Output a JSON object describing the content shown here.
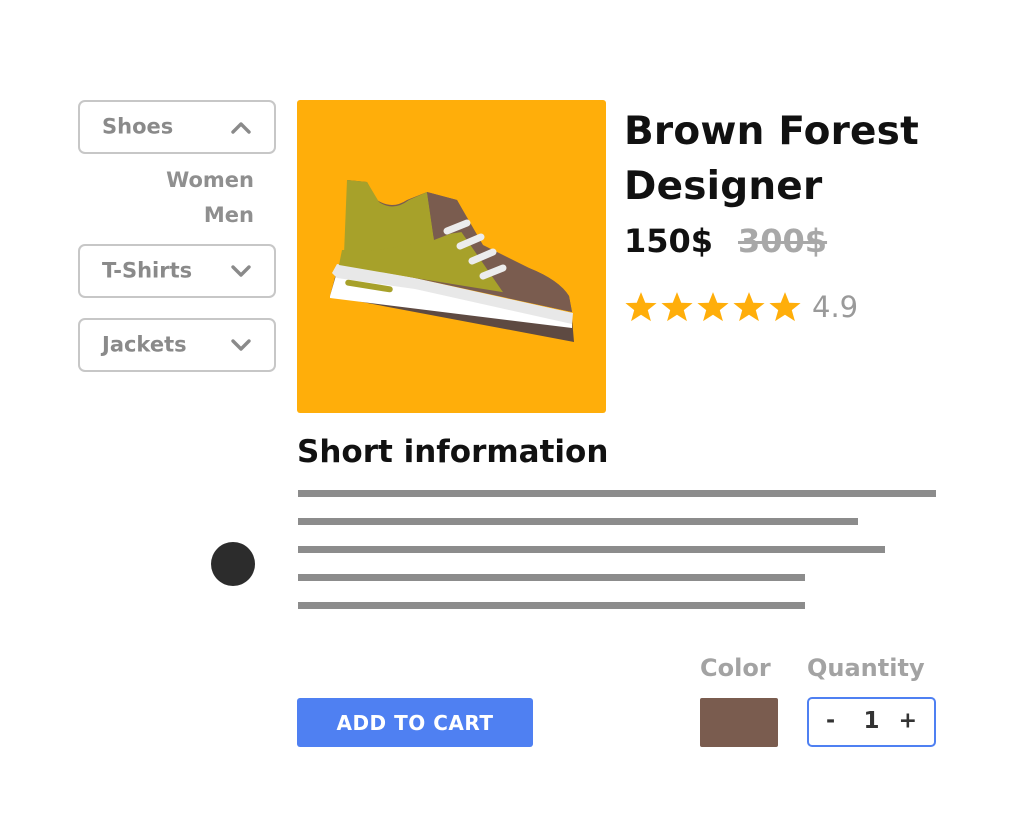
{
  "sidebar": {
    "categories": [
      {
        "label": "Shoes",
        "state": "expanded",
        "icon": "chevron-up-icon"
      },
      {
        "label": "T-Shirts",
        "state": "collapsed",
        "icon": "chevron-down-icon"
      },
      {
        "label": "Jackets",
        "state": "collapsed",
        "icon": "chevron-down-icon"
      }
    ],
    "subitems": [
      "Women",
      "Men"
    ]
  },
  "product": {
    "image_icon": "sneaker-icon",
    "title_line1": "Brown Forest",
    "title_line2": "Designer",
    "price": "150$",
    "old_price": "300$",
    "stars": 5,
    "rating": "4.9"
  },
  "info": {
    "title": "Short information"
  },
  "actions": {
    "add_to_cart_label": "ADD TO CART",
    "color_label": "Color",
    "selected_color": "#7a5c4f",
    "quantity_label": "Quantity",
    "quantity_minus": "-",
    "quantity_value": "1",
    "quantity_plus": "+"
  },
  "colors": {
    "accent": "#4f80f2",
    "image_background": "#ffae0a",
    "star": "#ffae0a",
    "text_muted": "#8a8a8a"
  }
}
